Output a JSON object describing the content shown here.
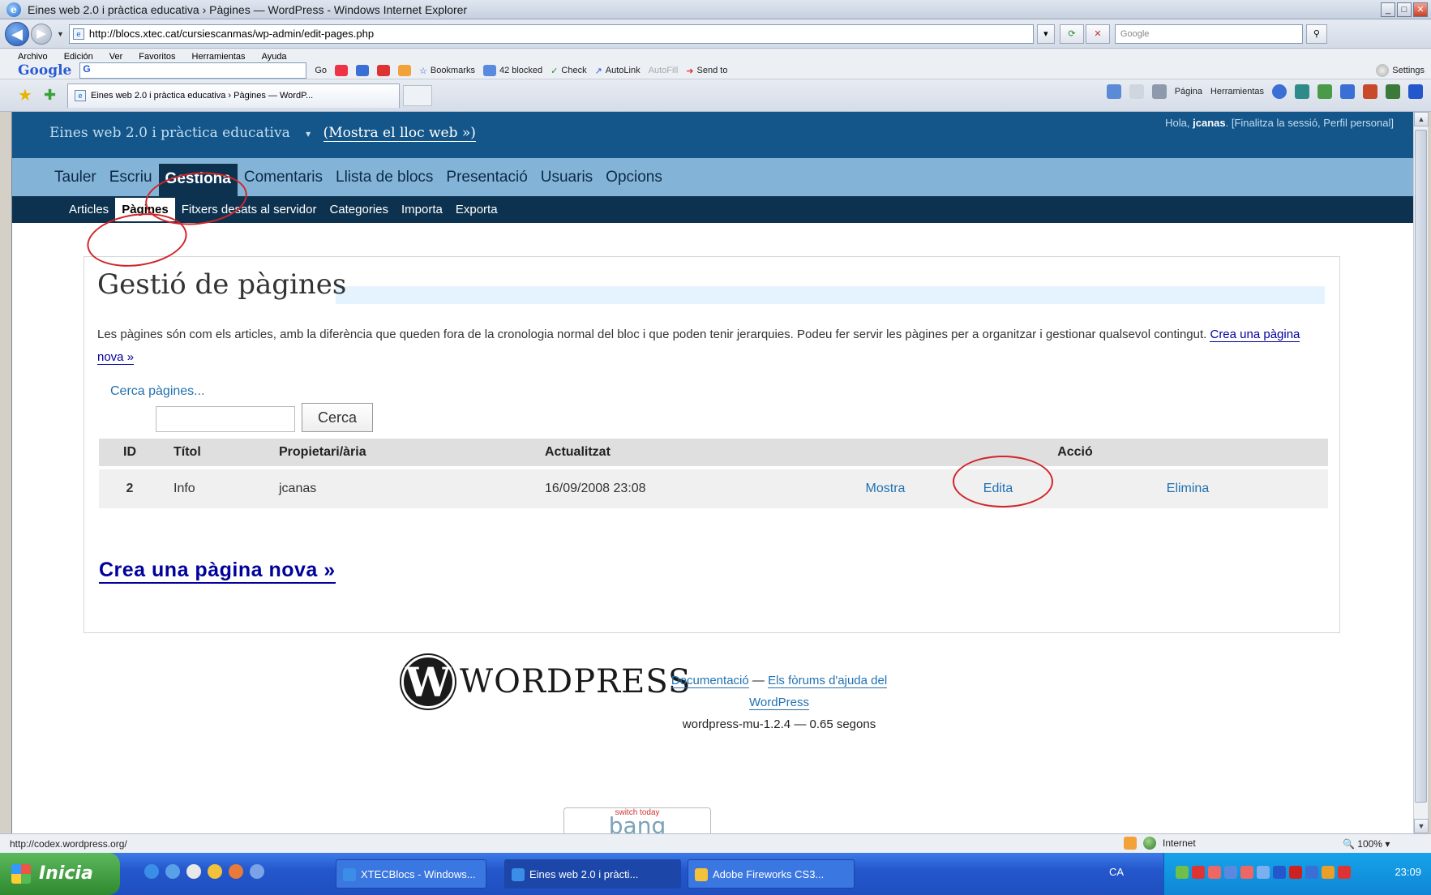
{
  "window": {
    "title": "Eines web 2.0 i pràctica educativa › Pàgines — WordPress - Windows Internet Explorer"
  },
  "address": {
    "url": "http://blocs.xtec.cat/cursiescanmas/wp-admin/edit-pages.php",
    "search_placeholder": "Google"
  },
  "menubar": {
    "items": [
      "Archivo",
      "Edición",
      "Ver",
      "Favoritos",
      "Herramientas",
      "Ayuda"
    ]
  },
  "googlebar": {
    "logo": "Google",
    "box_value": "G",
    "go": "Go",
    "bookmarks": "Bookmarks",
    "blocked": "42 blocked",
    "check": "Check",
    "autolink": "AutoLink",
    "autofill": "AutoFill",
    "sendto": "Send to",
    "settings": "Settings"
  },
  "tab": {
    "label": "Eines web 2.0 i pràctica educativa › Pàgines — WordP..."
  },
  "commandbar": {
    "page": "Página",
    "tools": "Herramientas"
  },
  "wp": {
    "blog_title": "Eines web 2.0 i pràctica educativa",
    "view_site": "(Mostra el lloc web »)",
    "greeting": "Hola, ",
    "username": "jcanas",
    "user_links": "[Finalitza la sessió, Perfil personal]",
    "menu": [
      "Tauler",
      "Escriu",
      "Gestiona",
      "Comentaris",
      "Llista de blocs",
      "Presentació",
      "Usuaris",
      "Opcions"
    ],
    "submenu": [
      "Articles",
      "Pàgines",
      "Fitxers desats al servidor",
      "Categories",
      "Importa",
      "Exporta"
    ],
    "heading": "Gestió de pàgines",
    "intro": "Les pàgines són com els articles, amb la diferència que queden fora de la cronologia normal del bloc i que poden tenir jerarquies. Podeu fer servir les pàgines per a organitzar i gestionar qualsevol contingut.",
    "intro_link": "Crea una pàgina nova »",
    "search_label": "Cerca pàgines...",
    "search_button": "Cerca",
    "table": {
      "headers": [
        "ID",
        "Títol",
        "Propietari/ària",
        "Actualitzat",
        "Acció"
      ],
      "rows": [
        {
          "id": "2",
          "title": "Info",
          "owner": "jcanas",
          "updated": "16/09/2008 23:08",
          "view": "Mostra",
          "edit": "Edita",
          "delete": "Elimina"
        }
      ]
    },
    "create_big": "Crea una pàgina nova »",
    "footer": {
      "logo_text": "WORDPRESS",
      "docs": "Documentació",
      "sep": " — ",
      "forums": "Els fòrums d'ajuda del WordPress",
      "version": "wordpress-mu-1.2.4 — 0.65 segons"
    },
    "badge": {
      "top": "switch today",
      "big": "bang"
    }
  },
  "status": {
    "url": "http://codex.wordpress.org/",
    "zone": "Internet",
    "zoom": "100%"
  },
  "taskbar": {
    "start": "Inicia",
    "tasks": [
      "XTECBlocs - Windows...",
      "Eines web 2.0 i pràcti...",
      "Adobe Fireworks CS3..."
    ],
    "lang": "CA",
    "clock": "23:09"
  }
}
